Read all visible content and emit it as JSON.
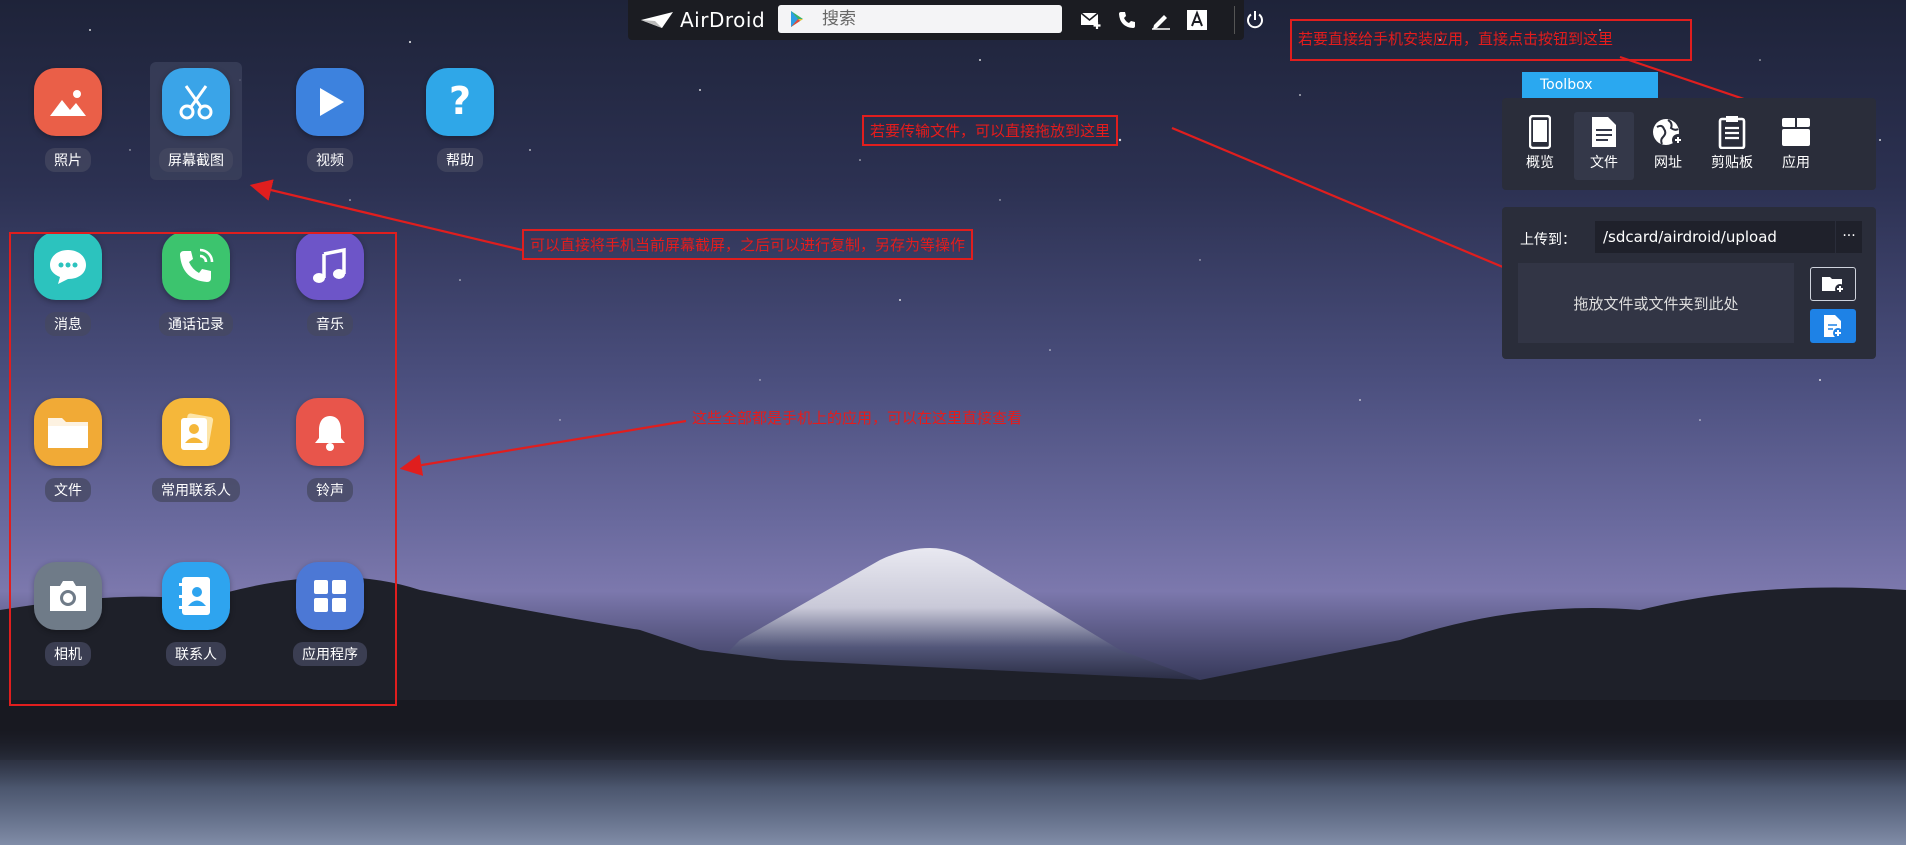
{
  "topbar": {
    "logo_text": "AirDroid",
    "search_placeholder": "搜索",
    "icons": [
      "message-add-icon",
      "phone-icon",
      "pen-icon",
      "text-a-icon",
      "power-icon"
    ]
  },
  "apps": [
    {
      "label": "照片",
      "icon": "photo-icon",
      "color": "#ea5f48"
    },
    {
      "label": "屏幕截图",
      "icon": "scissors-icon",
      "color": "#3aa4e8"
    },
    {
      "label": "视频",
      "icon": "play-icon",
      "color": "#3d82de"
    },
    {
      "label": "帮助",
      "icon": "question-icon",
      "color": "#2fa7e8"
    },
    {
      "label": "消息",
      "icon": "chat-icon",
      "color": "#2cc3be"
    },
    {
      "label": "通话记录",
      "icon": "phone-call-icon",
      "color": "#3cc46e"
    },
    {
      "label": "音乐",
      "icon": "music-icon",
      "color": "#6d55c8"
    },
    {
      "label": "文件",
      "icon": "folder-icon",
      "color": "#f1aa36"
    },
    {
      "label": "常用联系人",
      "icon": "contact-card-icon",
      "color": "#f5b73a"
    },
    {
      "label": "铃声",
      "icon": "bell-icon",
      "color": "#e8554b"
    },
    {
      "label": "相机",
      "icon": "camera-icon",
      "color": "#6f7b88"
    },
    {
      "label": "联系人",
      "icon": "address-book-icon",
      "color": "#2ea4ef"
    },
    {
      "label": "应用程序",
      "icon": "grid-icon",
      "color": "#4c78d5"
    }
  ],
  "annotations": {
    "install_app": "若要直接给手机安装应用，直接点击按钮到这里",
    "transfer_file": "若要传输文件，可以直接拖放到这里",
    "screenshot": "可以直接将手机当前屏幕截屏，之后可以进行复制，另存为等操作",
    "apps_note": "这些全部都是手机上的应用，可以在这里直接查看"
  },
  "toolbox": {
    "title": "Toolbox",
    "tools": [
      {
        "label": "概览",
        "icon": "phone-device-icon"
      },
      {
        "label": "文件",
        "icon": "document-icon"
      },
      {
        "label": "网址",
        "icon": "globe-icon"
      },
      {
        "label": "剪贴板",
        "icon": "clipboard-icon"
      },
      {
        "label": "应用",
        "icon": "app-box-icon"
      }
    ]
  },
  "upload": {
    "label": "上传到：",
    "path": "/sdcard/airdroid/upload",
    "more": "···",
    "drop_text": "拖放文件或文件夹到此处",
    "folder_button_icon": "folder-add-icon",
    "file_button_icon": "file-add-icon"
  },
  "colors": {
    "annotation": "#e01e1e",
    "toolbox_tab": "#2aa8f0",
    "panel_bg": "#2a2d3a",
    "upload_button": "#1e82e6"
  }
}
